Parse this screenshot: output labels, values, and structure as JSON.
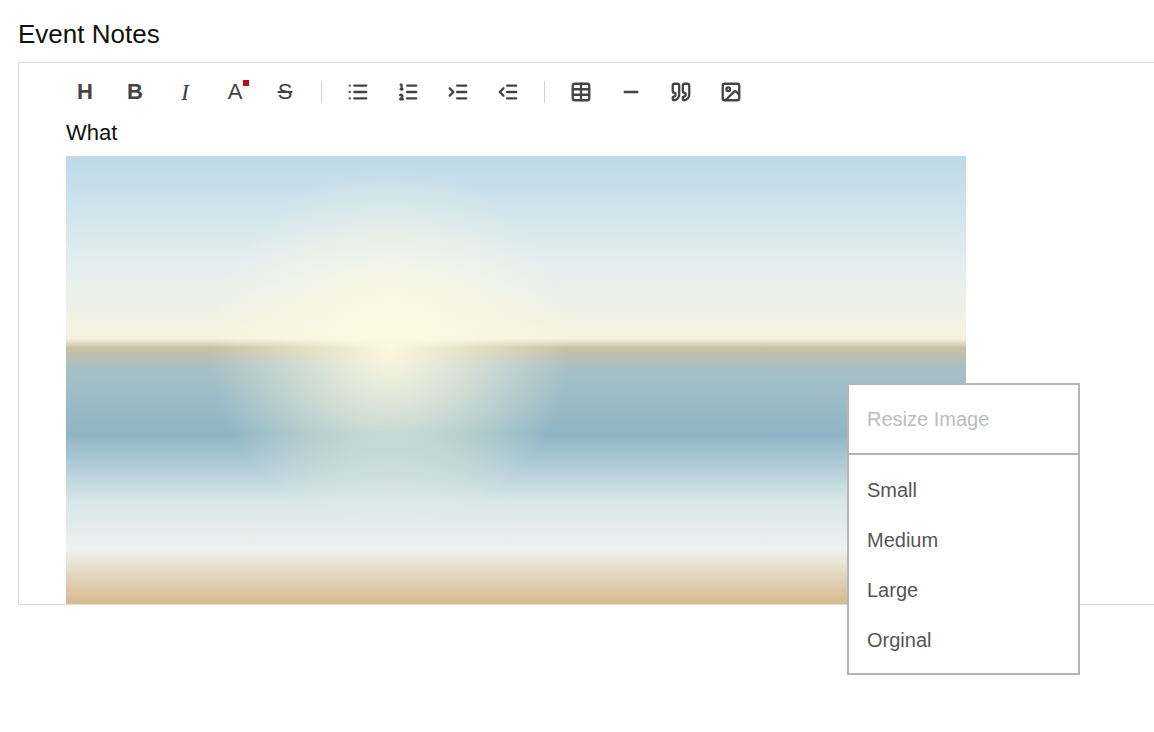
{
  "heading": "Event Notes",
  "toolbar": {
    "glyphs": [
      {
        "label": "H"
      },
      {
        "label": "B"
      },
      {
        "label": "I"
      },
      {
        "label": "A"
      },
      {
        "label": "S"
      }
    ]
  },
  "content": {
    "text": "What"
  },
  "context_menu": {
    "title": {
      "label": "Resize Image",
      "disabled": true
    },
    "items": [
      {
        "label": "Small"
      },
      {
        "label": "Medium"
      },
      {
        "label": "Large"
      },
      {
        "label": "Orginal"
      }
    ]
  }
}
